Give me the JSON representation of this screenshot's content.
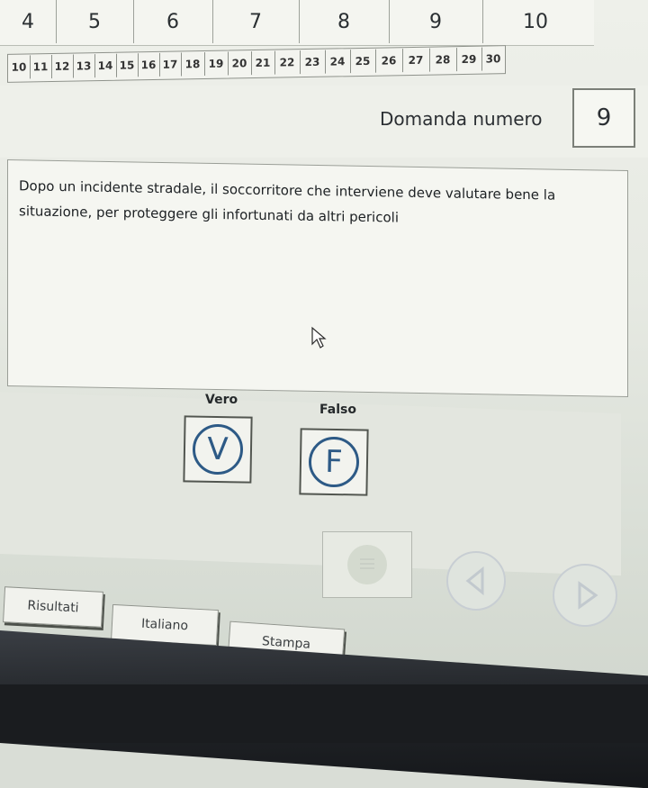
{
  "top_tabs": [
    "4",
    "5",
    "6",
    "7",
    "8",
    "9",
    "10"
  ],
  "number_tabs": [
    "10",
    "11",
    "12",
    "13",
    "14",
    "15",
    "16",
    "17",
    "18",
    "19",
    "20",
    "21",
    "22",
    "23",
    "24",
    "25",
    "26",
    "27",
    "28",
    "29",
    "30"
  ],
  "question": {
    "label": "Domanda numero",
    "number": "9",
    "text": "Dopo un incidente stradale, il soccorritore che interviene deve valutare bene la situazione, per proteggere gli infortunati da altri pericoli"
  },
  "answers": {
    "true_label": "Vero",
    "true_symbol": "V",
    "false_label": "Falso",
    "false_symbol": "F"
  },
  "buttons": {
    "results": "Risultati",
    "language": "Italiano",
    "print": "Stampa"
  },
  "icons": {
    "cursor": "arrow-cursor-icon",
    "list": "list-icon",
    "prev": "previous-arrow-icon",
    "next": "next-arrow-icon"
  },
  "colors": {
    "accent": "#2d5a86"
  }
}
